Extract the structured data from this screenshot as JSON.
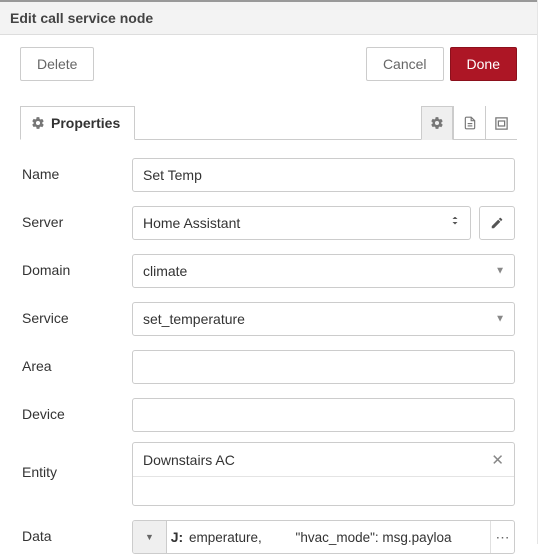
{
  "header": {
    "title": "Edit call service node"
  },
  "toolbar": {
    "delete": "Delete",
    "cancel": "Cancel",
    "done": "Done"
  },
  "tabs": {
    "properties": "Properties"
  },
  "form": {
    "name": {
      "label": "Name",
      "value": "Set Temp"
    },
    "server": {
      "label": "Server",
      "value": "Home Assistant"
    },
    "domain": {
      "label": "Domain",
      "value": "climate"
    },
    "service": {
      "label": "Service",
      "value": "set_temperature"
    },
    "area": {
      "label": "Area",
      "value": ""
    },
    "device": {
      "label": "Device",
      "value": ""
    },
    "entity": {
      "label": "Entity",
      "tag": "Downstairs AC"
    },
    "data": {
      "label": "Data",
      "typeGlyph": "J:",
      "value": "emperature,         \"hvac_mode\": msg.payloa"
    }
  }
}
